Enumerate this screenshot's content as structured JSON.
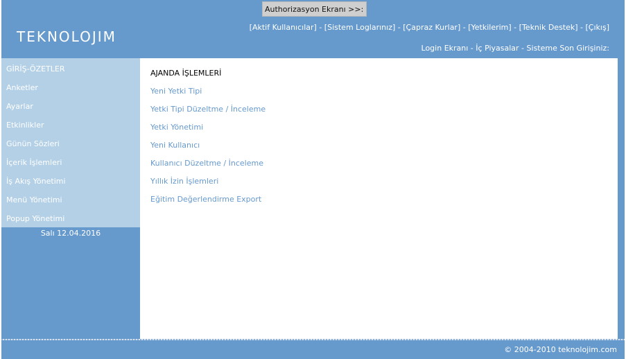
{
  "header": {
    "auth_button": "Authorizasyon Ekranı >>:",
    "logo": "TEKNOLOJIM",
    "top_links": [
      "[Aktif Kullanıcılar]",
      "[Sistem Loglarınız]",
      "[Çapraz Kurlar]",
      "[Yetkilerim]",
      "[Teknik Destek]",
      "[Çıkış]"
    ],
    "separator": " - ",
    "sub_links": {
      "login": "Login Ekranı",
      "market": "İç Piyasalar",
      "last_login": "Sisteme Son Girişiniz:"
    }
  },
  "sidebar": {
    "items": [
      "GİRİŞ-ÖZETLER",
      "Anketler",
      "Ayarlar",
      "Etkinlikler",
      "Günün Sözleri",
      "İçerik İşlemleri",
      "İş Akış Yönetimi",
      "Menü Yönetimi",
      "Popup Yönetimi"
    ],
    "date": "Salı 12.04.2016"
  },
  "main": {
    "title": "AJANDA İŞLEMLERİ",
    "links": [
      "Yeni Yetki Tipi",
      "Yetki Tipi Düzeltme / İnceleme",
      "Yetki Yönetimi",
      "Yeni Kullanıcı",
      "Kullanıcı Düzeltme / İnceleme",
      "Yıllık İzin İşlemleri",
      "Eğitim Değerlendirme Export"
    ]
  },
  "footer": {
    "copyright": "© 2004-2010 teknolojim.com"
  },
  "colors": {
    "brand_blue": "#6699cc",
    "menu_bg": "#b3d0e6",
    "link": "#6699cc"
  }
}
